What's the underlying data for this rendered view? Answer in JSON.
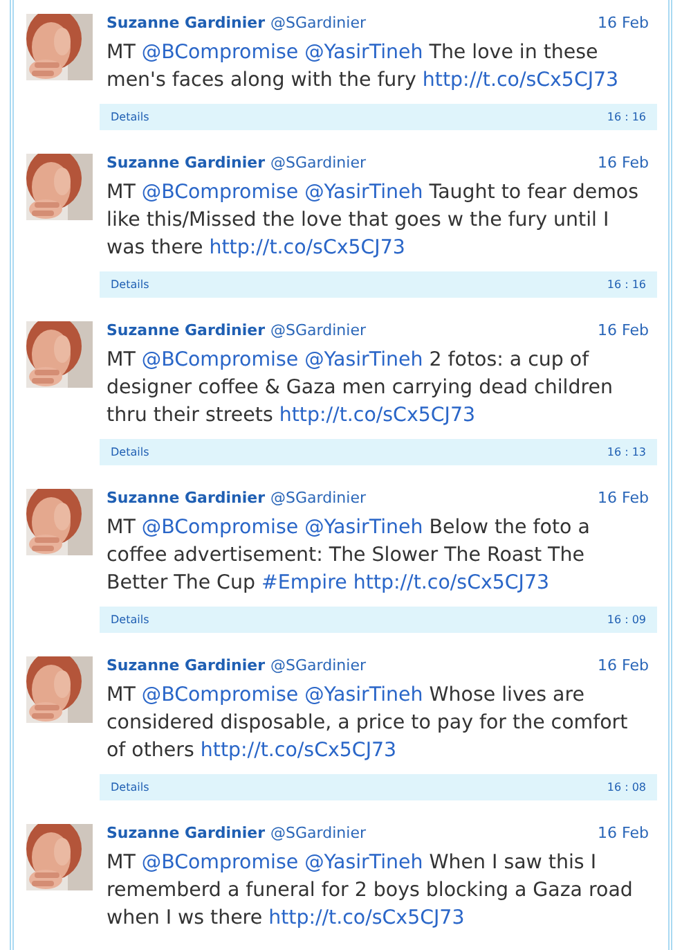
{
  "tweets": [
    {
      "name": "Suzanne Gardinier",
      "handle": "@SGardinier",
      "date": "16 Feb",
      "segments": [
        {
          "kind": "text",
          "text": "MT "
        },
        {
          "kind": "mention",
          "text": "@BCompromise"
        },
        {
          "kind": "mention",
          "text": "@YasirTineh"
        },
        {
          "kind": "text",
          "text": " The love in these men's faces along with the fury "
        },
        {
          "kind": "link",
          "text": "http://t.co/sCx5CJ73"
        }
      ],
      "details": {
        "label": "Details",
        "time": "16 : 16"
      }
    },
    {
      "name": "Suzanne Gardinier",
      "handle": "@SGardinier",
      "date": "16 Feb",
      "segments": [
        {
          "kind": "text",
          "text": "MT "
        },
        {
          "kind": "mention",
          "text": "@BCompromise"
        },
        {
          "kind": "mention",
          "text": "@YasirTineh"
        },
        {
          "kind": "text",
          "text": " Taught to fear demos like this/Missed the love that goes w the fury until I was there "
        },
        {
          "kind": "link",
          "text": "http://t.co/sCx5CJ73"
        }
      ],
      "details": {
        "label": "Details",
        "time": "16 : 16"
      }
    },
    {
      "name": "Suzanne Gardinier",
      "handle": "@SGardinier",
      "date": "16 Feb",
      "segments": [
        {
          "kind": "text",
          "text": "MT "
        },
        {
          "kind": "mention",
          "text": "@BCompromise"
        },
        {
          "kind": "mention",
          "text": "@YasirTineh"
        },
        {
          "kind": "text",
          "text": " 2 fotos: a cup of designer coffee & Gaza men carrying dead children thru their streets "
        },
        {
          "kind": "link",
          "text": "http://t.co/sCx5CJ73"
        }
      ],
      "details": {
        "label": "Details",
        "time": "16 : 13"
      }
    },
    {
      "name": "Suzanne Gardinier",
      "handle": "@SGardinier",
      "date": "16 Feb",
      "segments": [
        {
          "kind": "text",
          "text": "MT "
        },
        {
          "kind": "mention",
          "text": "@BCompromise"
        },
        {
          "kind": "mention",
          "text": "@YasirTineh"
        },
        {
          "kind": "text",
          "text": " Below the foto a coffee advertisement: The Slower The Roast The Better The Cup "
        },
        {
          "kind": "hashtag",
          "text": "#Empire"
        },
        {
          "kind": "link",
          "text": "http://t.co/sCx5CJ73"
        }
      ],
      "details": {
        "label": "Details",
        "time": "16 : 09"
      }
    },
    {
      "name": "Suzanne Gardinier",
      "handle": "@SGardinier",
      "date": "16 Feb",
      "segments": [
        {
          "kind": "text",
          "text": "MT "
        },
        {
          "kind": "mention",
          "text": "@BCompromise"
        },
        {
          "kind": "mention",
          "text": "@YasirTineh"
        },
        {
          "kind": "text",
          "text": " Whose lives are considered disposable, a price to pay for the comfort of others "
        },
        {
          "kind": "link",
          "text": "http://t.co/sCx5CJ73"
        }
      ],
      "details": {
        "label": "Details",
        "time": "16 : 08"
      }
    },
    {
      "name": "Suzanne Gardinier",
      "handle": "@SGardinier",
      "date": "16 Feb",
      "segments": [
        {
          "kind": "text",
          "text": "MT "
        },
        {
          "kind": "mention",
          "text": "@BCompromise"
        },
        {
          "kind": "mention",
          "text": "@YasirTineh"
        },
        {
          "kind": "text",
          "text": " When I saw this I rememberd a funeral for 2 boys blocking a Gaza road when I ws there "
        },
        {
          "kind": "link",
          "text": "http://t.co/sCx5CJ73"
        }
      ]
    }
  ]
}
